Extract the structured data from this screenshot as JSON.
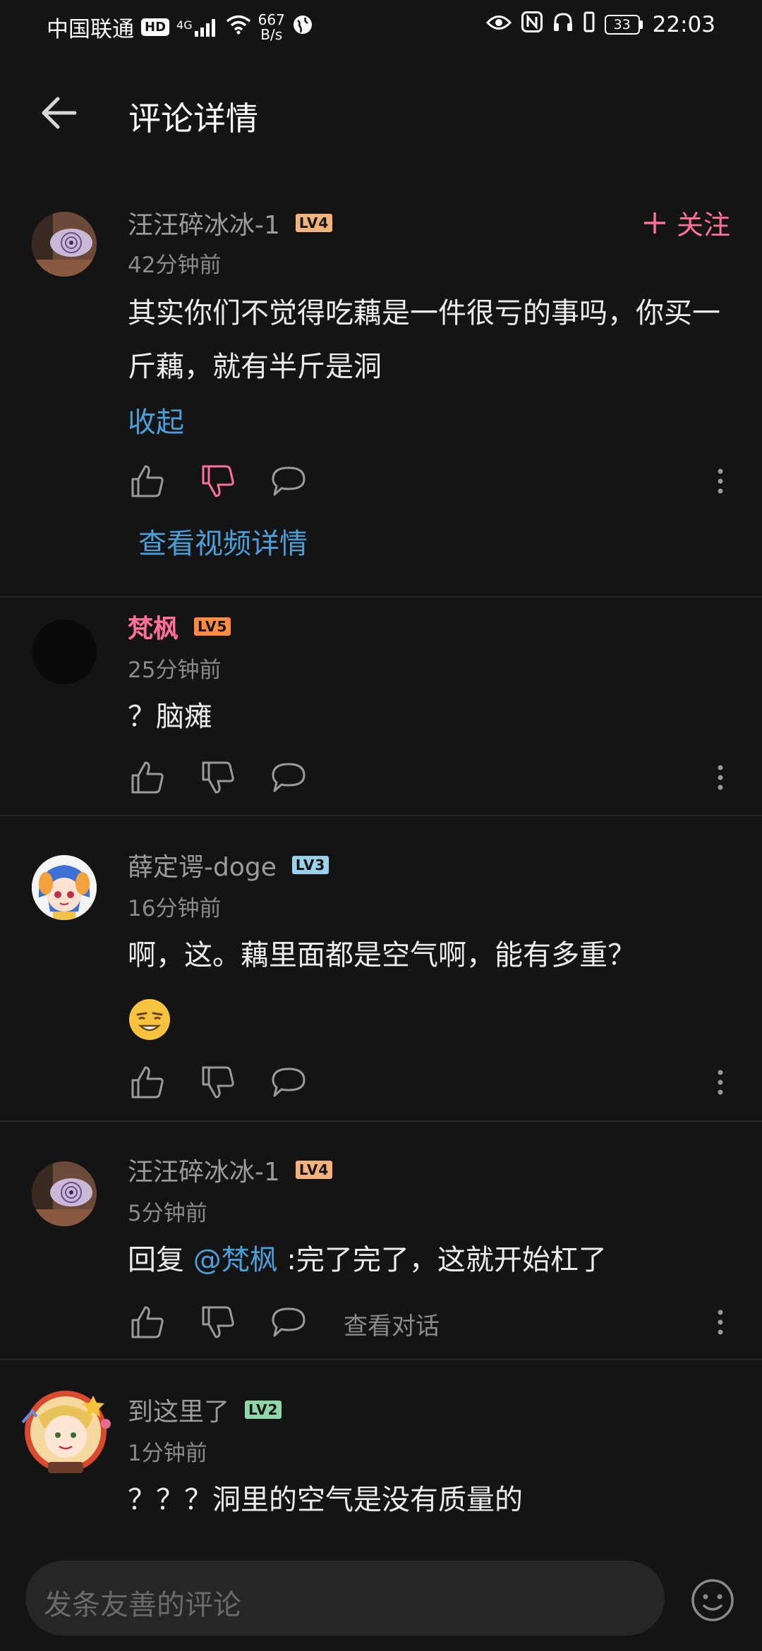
{
  "status_bar": {
    "carrier": "中国联通",
    "hd": "HD",
    "network": "4G",
    "speed_value": "667",
    "speed_unit": "B/s",
    "battery": "33",
    "time": "22:03"
  },
  "header": {
    "title": "评论详情"
  },
  "main_comment": {
    "username": "汪汪碎冰冰-1",
    "level": "LV4",
    "follow_label": "关注",
    "time": "42分钟前",
    "text": "其实你们不觉得吃藕是一件很亏的事吗，你买一斤藕，就有半斤是洞",
    "collapse_label": "收起",
    "view_video_label": "查看视频详情"
  },
  "replies": [
    {
      "username": "梵枫",
      "level": "LV5",
      "time": "25分钟前",
      "text": "？脑瘫"
    },
    {
      "username": "薛定谔-doge",
      "level": "LV3",
      "time": "16分钟前",
      "text": "啊，这。藕里面都是空气啊，能有多重？"
    },
    {
      "username": "汪汪碎冰冰-1",
      "level": "LV4",
      "time": "5分钟前",
      "reply_prefix": "回复 ",
      "mention": "@梵枫",
      "text": " :完了完了，这就开始杠了",
      "view_conversation": "查看对话"
    },
    {
      "username": "到这里了",
      "level": "LV2",
      "time": "1分钟前",
      "text": "？？？洞里的空气是没有质量的"
    }
  ],
  "bottom_bar": {
    "placeholder": "发条友善的评论"
  },
  "colors": {
    "accent_pink": "#ff6f9a",
    "link_blue": "#4a9fd8",
    "lv2": "#8fd6a8",
    "lv3": "#9bd0ea",
    "lv4": "#f3b27a",
    "lv5": "#ff8a3d"
  },
  "icons": [
    "back-arrow-icon",
    "plus-icon",
    "thumb-up-icon",
    "thumb-down-icon",
    "comment-icon",
    "more-vertical-icon",
    "emoji-icon"
  ]
}
